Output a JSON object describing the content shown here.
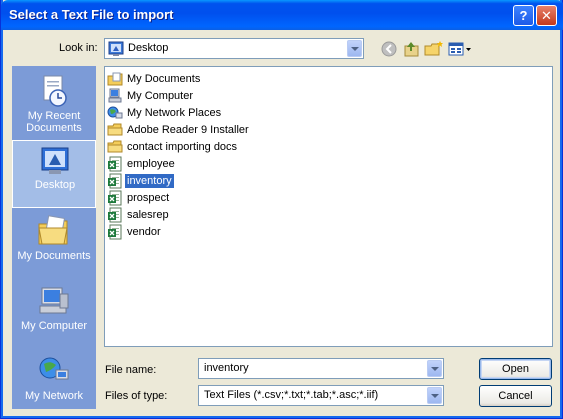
{
  "window": {
    "title": "Select a Text File to import"
  },
  "titlebar": {
    "help_glyph": "?",
    "close_glyph": "✕"
  },
  "lookin": {
    "label": "Look in:",
    "value": "Desktop",
    "icon": "desktop-icon"
  },
  "toolbar": {
    "back_icon": "back-icon",
    "up_icon": "up-folder-icon",
    "new_folder_icon": "new-folder-icon",
    "views_icon": "views-menu-icon"
  },
  "places": [
    {
      "label_line1": "My Recent",
      "label_line2": "Documents",
      "icon": "recent-documents-icon"
    },
    {
      "label_line1": "Desktop",
      "label_line2": "",
      "icon": "desktop-icon"
    },
    {
      "label_line1": "My Documents",
      "label_line2": "",
      "icon": "my-documents-icon"
    },
    {
      "label_line1": "My Computer",
      "label_line2": "",
      "icon": "my-computer-icon"
    },
    {
      "label_line1": "My Network",
      "label_line2": "",
      "icon": "my-network-icon"
    }
  ],
  "files": [
    {
      "name": "My Documents",
      "type": "my-documents"
    },
    {
      "name": "My Computer",
      "type": "computer"
    },
    {
      "name": "My Network Places",
      "type": "network"
    },
    {
      "name": "Adobe Reader 9 Installer",
      "type": "folder"
    },
    {
      "name": "contact importing docs",
      "type": "folder"
    },
    {
      "name": "employee",
      "type": "excel"
    },
    {
      "name": "inventory",
      "type": "excel",
      "selected": true
    },
    {
      "name": "prospect",
      "type": "excel"
    },
    {
      "name": "salesrep",
      "type": "excel"
    },
    {
      "name": "vendor",
      "type": "excel"
    }
  ],
  "filename": {
    "label": "File name:",
    "value": "inventory"
  },
  "filetype": {
    "label": "Files of type:",
    "value": "Text Files (*.csv;*.txt;*.tab;*.asc;*.iif)"
  },
  "buttons": {
    "open": "Open",
    "cancel": "Cancel"
  }
}
